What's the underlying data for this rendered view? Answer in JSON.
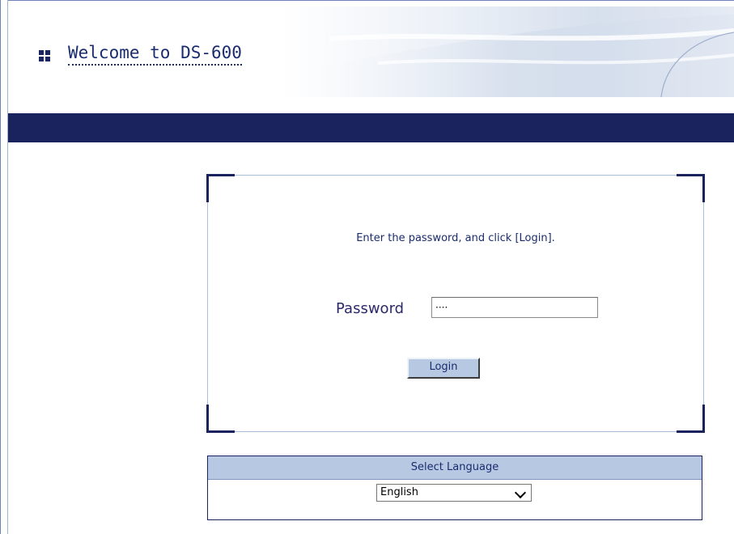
{
  "header": {
    "title": "Welcome to DS-600"
  },
  "login": {
    "instruction": "Enter the password, and click [Login].",
    "password_label": "Password",
    "password_value": "····",
    "login_button": "Login"
  },
  "language": {
    "header": "Select Language",
    "selected": "English"
  },
  "colors": {
    "navbar": "#1b235e",
    "accent_light": "#b7c9e2",
    "text": "#1a2c6e"
  }
}
